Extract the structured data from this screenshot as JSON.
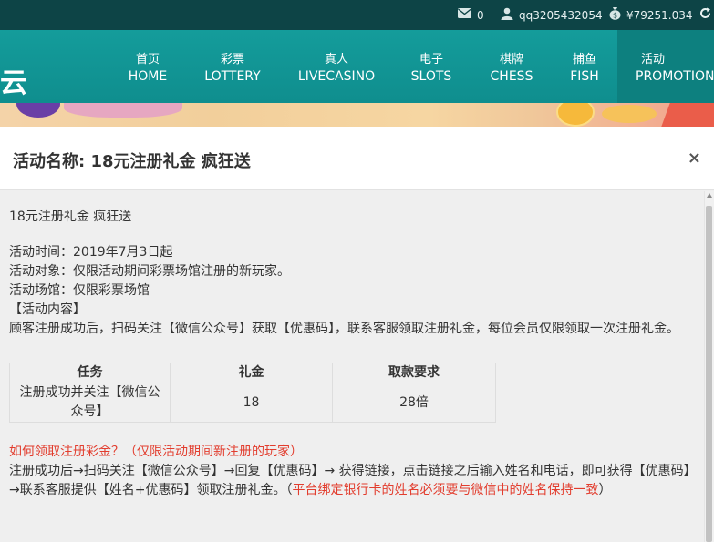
{
  "topbar": {
    "mail_count": "0",
    "username": "qq3205432054",
    "balance": "¥79251.034"
  },
  "nav": {
    "logo_fragment": "云",
    "items": [
      {
        "cn": "首页",
        "en": "HOME"
      },
      {
        "cn": "彩票",
        "en": "LOTTERY"
      },
      {
        "cn": "真人",
        "en": "LIVECASINO"
      },
      {
        "cn": "电子",
        "en": "SLOTS"
      },
      {
        "cn": "棋牌",
        "en": "CHESS"
      },
      {
        "cn": "捕鱼",
        "en": "FISH"
      },
      {
        "cn": "活动",
        "en": "PROMOTION"
      }
    ],
    "active_index": 6
  },
  "modal": {
    "title": "活动名称: 18元注册礼金 疯狂送",
    "close_label": "×",
    "intro": "18元注册礼金  疯狂送",
    "lines": [
      "活动时间：2019年7月3日起",
      "活动对象：仅限活动期间彩票场馆注册的新玩家。",
      "活动场馆：仅限彩票场馆",
      "【活动内容】",
      "顾客注册成功后，扫码关注【微信公众号】获取【优惠码】，联系客服领取注册礼金，每位会员仅限领取一次注册礼金。"
    ],
    "table": {
      "headers": [
        "任务",
        "礼金",
        "取款要求"
      ],
      "rows": [
        [
          "注册成功并关注【微信公众号】",
          "18",
          "28倍"
        ]
      ]
    },
    "faq_question": "如何领取注册彩金？（仅限活动期间新注册的玩家）",
    "faq_answer": "注册成功后→扫码关注【微信公众号】→回复【优惠码】→ 获得链接，点击链接之后输入姓名和电话，即可获得【优惠码】→联系客服提供【姓名+优惠码】领取注册礼金。",
    "faq_note_open": "（",
    "faq_note": "平台绑定银行卡的姓名必须要与微信中的姓名保持一致",
    "faq_note_close": "）"
  },
  "colors": {
    "topbar_bg": "#0d4446",
    "nav_bg": "#149c9b",
    "nav_active_bg": "#0d807f",
    "highlight_red": "#e23d2e"
  }
}
